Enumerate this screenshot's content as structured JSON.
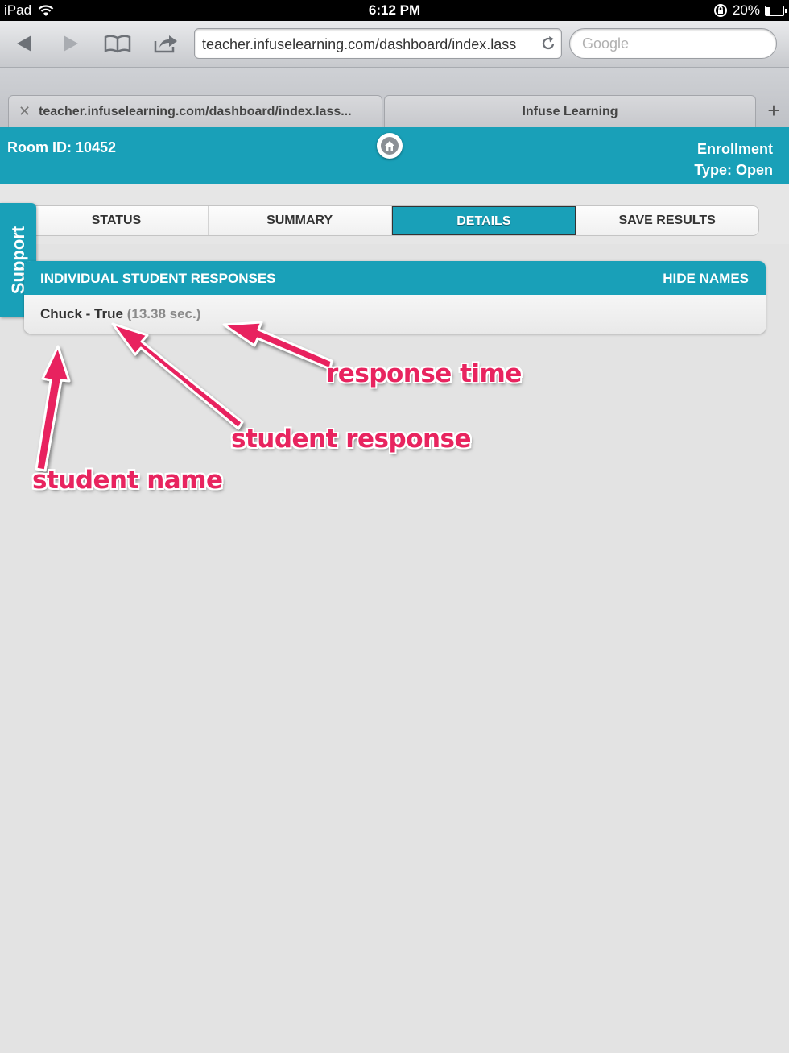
{
  "status_bar": {
    "device": "iPad",
    "time": "6:12 PM",
    "battery": "20%",
    "battery_level": 0.2
  },
  "browser": {
    "url": "teacher.infuselearning.com/dashboard/index.lass",
    "search_placeholder": "Google",
    "tabs": [
      {
        "title": "teacher.infuselearning.com/dashboard/index.lass...",
        "active": true
      },
      {
        "title": "Infuse Learning",
        "active": false
      }
    ],
    "new_tab": "+"
  },
  "app": {
    "room_id": "Room ID: 10452",
    "enrollment_label": "Enrollment",
    "enrollment_type": "Type: Open",
    "support_label": "Support",
    "tabs": [
      "STATUS",
      "SUMMARY",
      "DETAILS",
      "SAVE RESULTS"
    ],
    "active_tab": "DETAILS",
    "panel": {
      "title": "INDIVIDUAL STUDENT RESPONSES",
      "hide_names": "HIDE NAMES",
      "responses": [
        {
          "name_response": "Chuck - True",
          "time": "(13.38 sec.)"
        }
      ]
    }
  },
  "annotations": {
    "response_time": "response time",
    "student_response": "student response",
    "student_name": "student name",
    "color": "#e8245f"
  },
  "colors": {
    "brand": "#19a0b8",
    "page_bg": "#e3e3e3"
  }
}
